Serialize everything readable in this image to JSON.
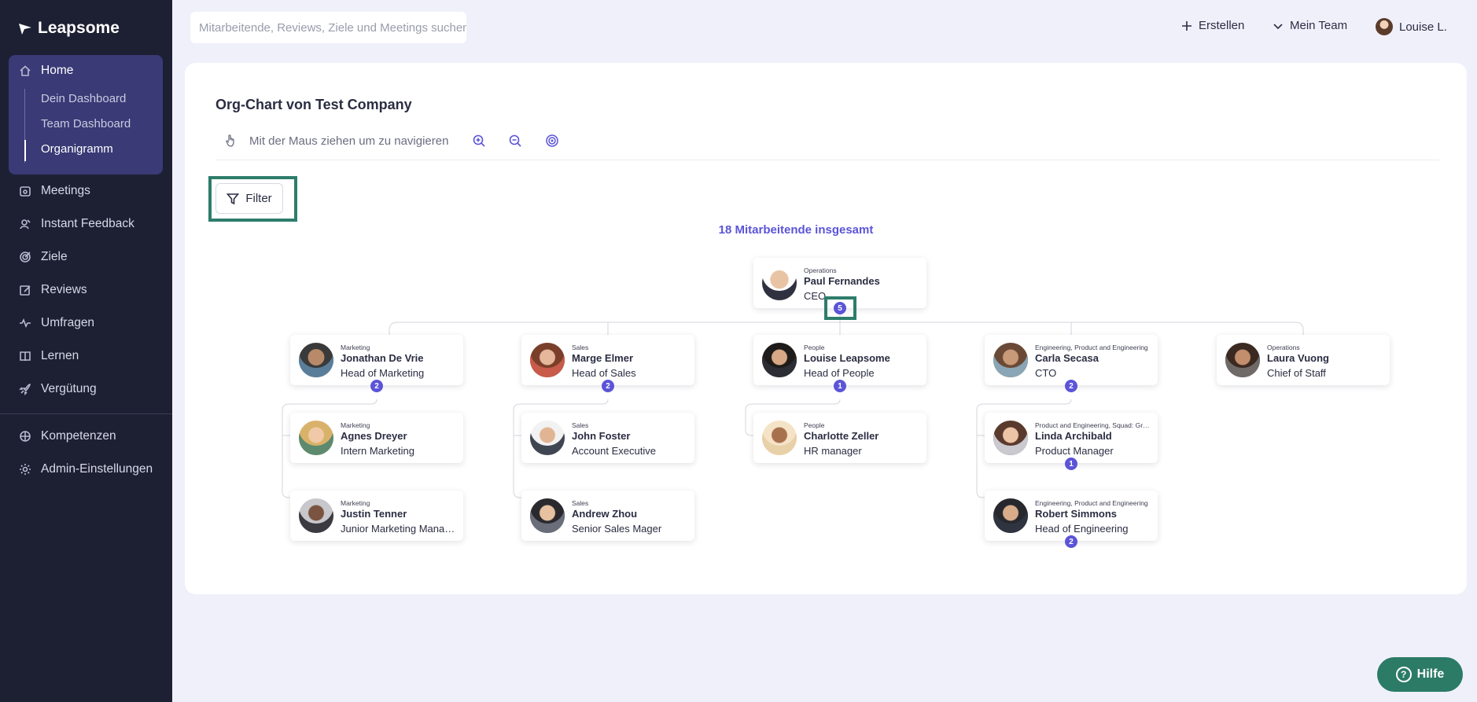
{
  "app": {
    "name": "Leapsome"
  },
  "sidebar": {
    "home": {
      "label": "Home",
      "sub": [
        {
          "label": "Dein Dashboard"
        },
        {
          "label": "Team Dashboard"
        },
        {
          "label": "Organigramm",
          "active": true
        }
      ]
    },
    "items": [
      {
        "label": "Meetings",
        "icon": "meetings-icon"
      },
      {
        "label": "Instant Feedback",
        "icon": "feedback-icon"
      },
      {
        "label": "Ziele",
        "icon": "target-icon"
      },
      {
        "label": "Reviews",
        "icon": "edit-icon"
      },
      {
        "label": "Umfragen",
        "icon": "pulse-icon"
      },
      {
        "label": "Lernen",
        "icon": "book-icon"
      },
      {
        "label": "Vergütung",
        "icon": "rocket-icon"
      }
    ],
    "items2": [
      {
        "label": "Kompetenzen",
        "icon": "competency-icon"
      },
      {
        "label": "Admin-Einstellungen",
        "icon": "gear-icon"
      }
    ]
  },
  "topbar": {
    "search_placeholder": "Mitarbeitende, Reviews, Ziele und Meetings suchen",
    "create_label": "Erstellen",
    "team_label": "Mein Team",
    "user_label": "Louise L."
  },
  "main": {
    "title": "Org-Chart von Test Company",
    "hint": "Mit der Maus ziehen um zu navigieren",
    "filter_label": "Filter",
    "total": "18 Mitarbeitende insgesamt"
  },
  "org": {
    "ceo": {
      "dept": "Operations",
      "name": "Paul Fernandes",
      "role": "CEO",
      "count": "5"
    },
    "level1": [
      {
        "dept": "Marketing",
        "name": "Jonathan De Vrie",
        "role": "Head of Marketing",
        "count": "2"
      },
      {
        "dept": "Sales",
        "name": "Marge Elmer",
        "role": "Head of Sales",
        "count": "2"
      },
      {
        "dept": "People",
        "name": "Louise Leapsome",
        "role": "Head of People",
        "count": "1"
      },
      {
        "dept": "Engineering, Product and Engineering",
        "name": "Carla Secasa",
        "role": "CTO",
        "count": "2"
      },
      {
        "dept": "Operations",
        "name": "Laura Vuong",
        "role": "Chief of Staff"
      }
    ],
    "level2": [
      {
        "dept": "Marketing",
        "name": "Agnes Dreyer",
        "role": "Intern Marketing"
      },
      {
        "dept": "Marketing",
        "name": "Justin Tenner",
        "role": "Junior Marketing Manager"
      },
      {
        "dept": "Sales",
        "name": "John Foster",
        "role": "Account Executive"
      },
      {
        "dept": "Sales",
        "name": "Andrew Zhou",
        "role": "Senior Sales Mager"
      },
      {
        "dept": "People",
        "name": "Charlotte Zeller",
        "role": "HR manager"
      },
      {
        "dept": "Product and Engineering, Squad: Growth",
        "name": "Linda Archibald",
        "role": "Product Manager",
        "count": "1"
      },
      {
        "dept": "Engineering, Product and Engineering",
        "name": "Robert Simmons",
        "role": "Head of Engineering",
        "count": "2"
      }
    ]
  },
  "help": {
    "label": "Hilfe"
  }
}
